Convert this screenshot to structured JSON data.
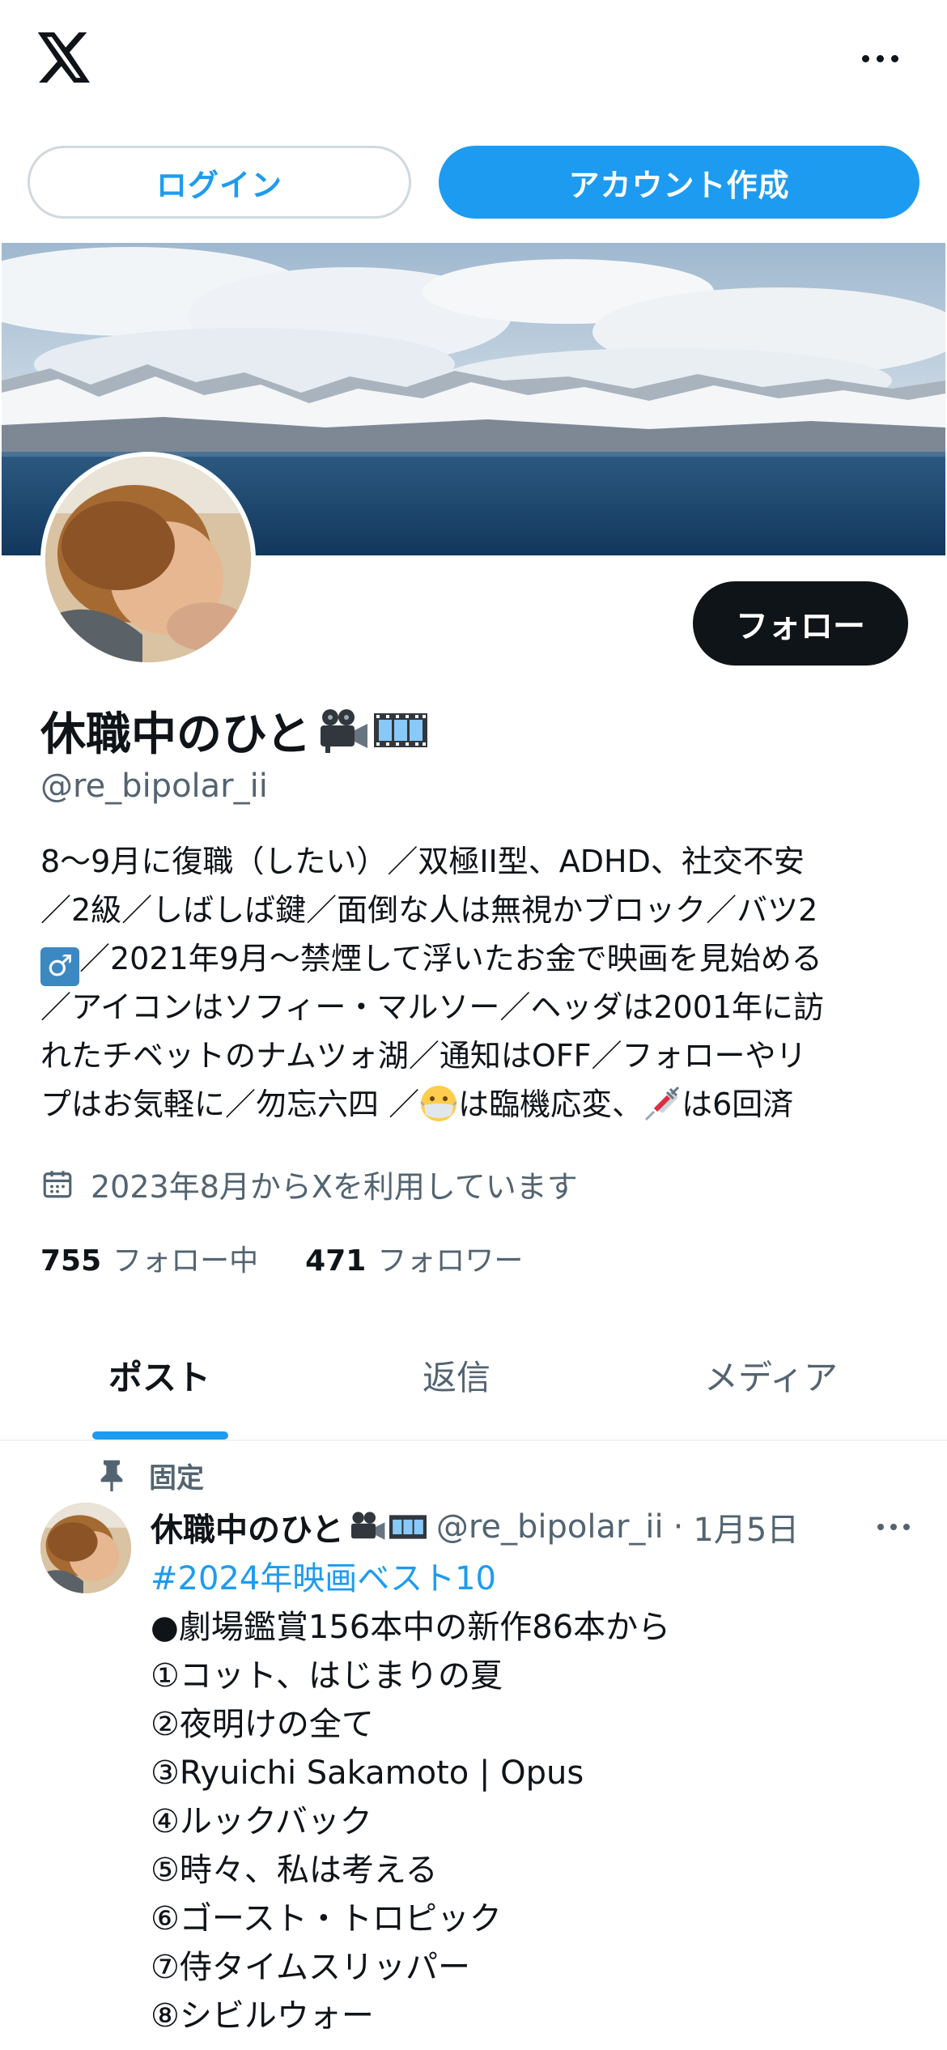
{
  "header": {
    "logo_icon": "x-logo-icon",
    "more_icon": "more-horizontal-icon"
  },
  "auth": {
    "login_label": "ログイン",
    "signup_label": "アカウント作成"
  },
  "profile": {
    "follow_label": "フォロー",
    "display_name": "休職中のひと",
    "name_emojis": [
      "movie-camera-icon",
      "film-frames-icon"
    ],
    "handle": "@re_bipolar_ii",
    "bio_lines": [
      {
        "a": "8〜9月に復職（したい）／双極II型、ADHD、社交不安"
      },
      {
        "a": "／2級／しばしば鍵／面倒な人は無視かブロック／バツ2"
      },
      {
        "a": "／2021年9月〜禁煙して浮いたお金で映画を見始める",
        "badge": "♂"
      },
      {
        "a": "／アイコンはソフィー・マルソー／ヘッダは2001年に訪"
      },
      {
        "a": "れたチベットのナムツォ湖／通知はOFF／フォローやリ"
      },
      {
        "a": "プはお気軽に／勿忘六四 ／",
        "b": "は臨機応変、",
        "c": "は6回済"
      }
    ],
    "joined_text": "2023年8月からXを利用しています",
    "following_count": "755",
    "following_label": "フォロー中",
    "followers_count": "471",
    "followers_label": "フォロワー"
  },
  "tabs": [
    {
      "label": "ポスト",
      "active": true
    },
    {
      "label": "返信",
      "active": false
    },
    {
      "label": "メディア",
      "active": false
    }
  ],
  "post": {
    "pinned_label": "固定",
    "author_name": "休職中のひと",
    "author_handle": "@re_bipolar_ii",
    "separator": "·",
    "date": "1月5日",
    "hashtag": "#2024年映画ベスト10",
    "lines": [
      "●劇場鑑賞156本中の新作86本から",
      "①コット、はじまりの夏",
      "②夜明けの全て",
      "③Ryuichi Sakamoto | Opus",
      "④ルックバック",
      "⑤時々、私は考える",
      "⑥ゴースト・トロピック",
      "⑦侍タイムスリッパー",
      "⑧シビルウォー"
    ]
  },
  "colors": {
    "accent": "#1d9bf0",
    "text": "#0f1419",
    "secondary": "#536471",
    "border": "#cfd9de"
  }
}
